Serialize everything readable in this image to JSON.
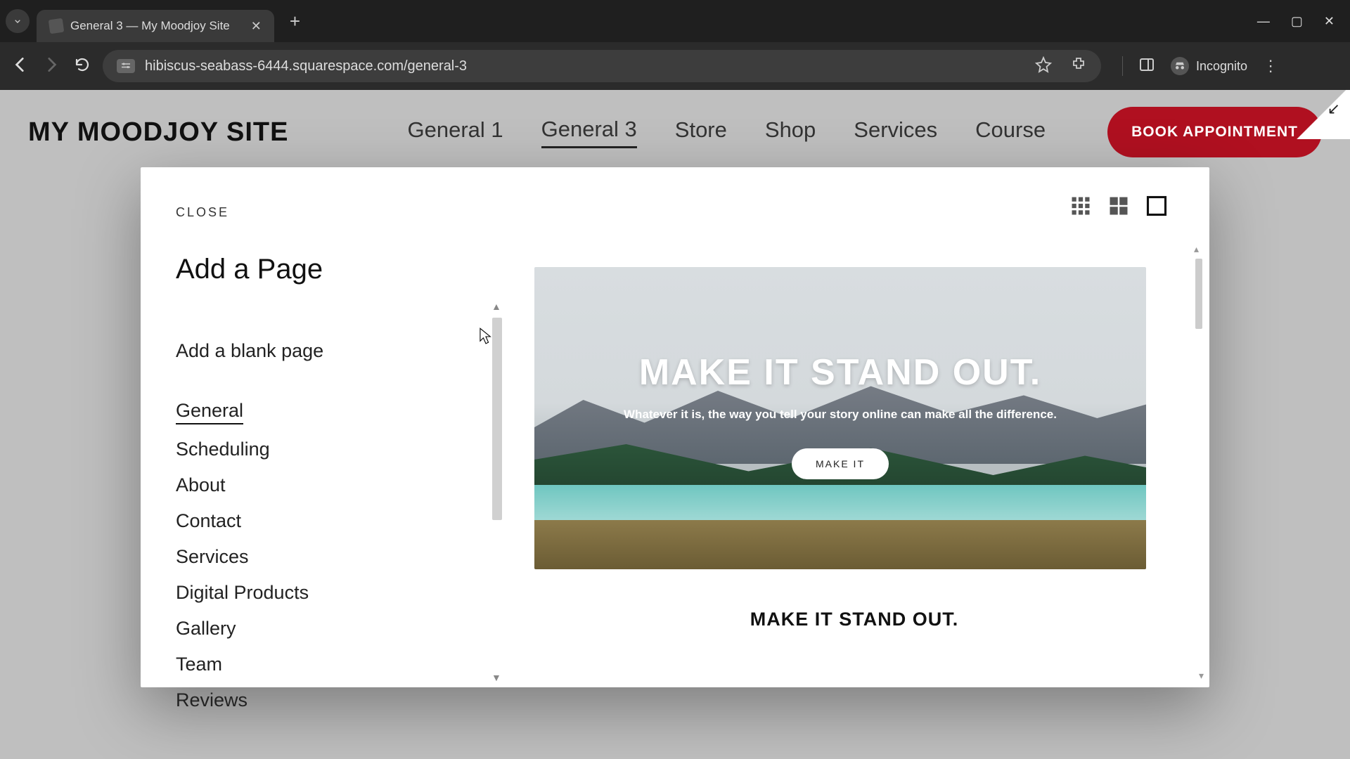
{
  "browser": {
    "tab_title": "General 3 — My Moodjoy Site",
    "url": "hibiscus-seabass-6444.squarespace.com/general-3",
    "incognito_label": "Incognito"
  },
  "site": {
    "logo": "MY MOODJOY SITE",
    "nav": {
      "items": [
        "General 1",
        "General 3",
        "Store",
        "Shop",
        "Services",
        "Course"
      ],
      "active_index": 1
    },
    "cta": "BOOK APPOINTMENT"
  },
  "modal": {
    "close": "CLOSE",
    "title": "Add a Page",
    "blank": "Add a blank page",
    "categories": [
      "General",
      "Scheduling",
      "About",
      "Contact",
      "Services",
      "Digital Products",
      "Gallery",
      "Team",
      "Reviews"
    ],
    "active_category_index": 0,
    "preview": {
      "hero_title": "MAKE IT STAND OUT.",
      "hero_sub": "Whatever it is, the way you tell your story online can make all the difference.",
      "hero_button": "MAKE IT",
      "second_title": "MAKE IT STAND OUT."
    }
  }
}
